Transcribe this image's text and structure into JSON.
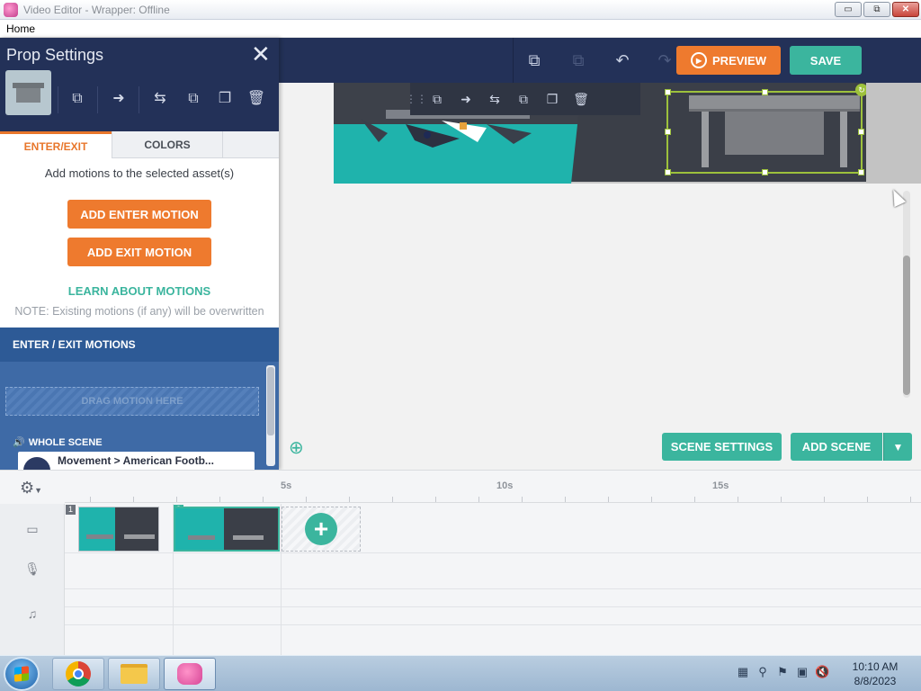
{
  "window": {
    "title": "Video Editor - Wrapper: Offline",
    "controls": {
      "minimize": "▭",
      "maximize": "⧉",
      "close": "✕"
    }
  },
  "menubar": {
    "items": [
      "Home"
    ]
  },
  "toolbar": {
    "preview_label": "PREVIEW",
    "save_label": "SAVE",
    "icons": [
      "copy-icon",
      "paste-icon",
      "undo-icon",
      "redo-icon",
      "settings-icon"
    ]
  },
  "panel": {
    "title": "Prop Settings",
    "close_glyph": "✕",
    "action_icons": [
      "swap-icon",
      "motion-icon",
      "flip-icon",
      "copy-icon",
      "duplicate-icon",
      "delete-icon"
    ],
    "tabs": [
      {
        "label": "ENTER/EXIT",
        "active": true
      },
      {
        "label": "COLORS",
        "active": false
      }
    ],
    "motion_hint": "Add motions to the selected asset(s)",
    "add_enter_label": "ADD ENTER MOTION",
    "add_exit_label": "ADD EXIT MOTION",
    "learn_label": "LEARN ABOUT MOTIONS",
    "note": "NOTE: Existing motions (if any) will be overwritten",
    "motions_header": "ENTER / EXIT MOTIONS",
    "drag_label": "DRAG MOTION HERE",
    "whole_scene_label": "WHOLE SCENE",
    "motion_item": "Movement > American Footb..."
  },
  "stage": {
    "scene_settings_label": "SCENE SETTINGS",
    "add_scene_label": "ADD SCENE",
    "zoom_icon": "zoom-in-icon"
  },
  "timeline": {
    "ruler_labels": [
      "5s",
      "10s",
      "15s"
    ],
    "scenes": [
      {
        "number": "1",
        "selected": false
      },
      {
        "number": "2",
        "selected": true
      }
    ],
    "tracks": [
      "video-track-icon",
      "voice-track-icon",
      "music-track-icon"
    ]
  },
  "taskbar": {
    "apps": [
      "chrome",
      "file-explorer",
      "wrapper-offline"
    ],
    "time": "10:10 AM",
    "date": "8/8/2023"
  },
  "colors": {
    "navy": "#233158",
    "accent_orange": "#ee7a2e",
    "accent_teal": "#3bb59e",
    "motions_blue": "#2d5a96",
    "selection_green": "#9dc13c"
  }
}
